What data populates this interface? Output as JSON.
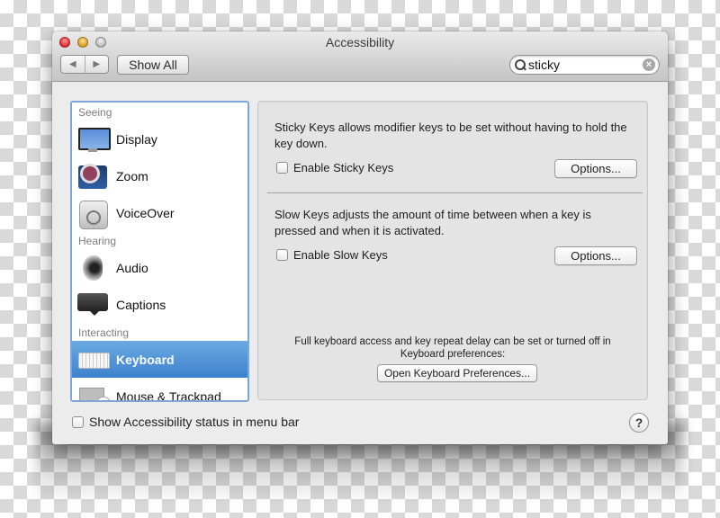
{
  "window": {
    "title": "Accessibility"
  },
  "toolbar": {
    "back_icon": "◀",
    "forward_icon": "▶",
    "show_all_label": "Show All",
    "search": {
      "value": "sticky",
      "clear_icon": "×"
    }
  },
  "sidebar": {
    "sections": [
      {
        "label": "Seeing",
        "items": [
          {
            "label": "Display",
            "icon": "display-icon"
          },
          {
            "label": "Zoom",
            "icon": "zoom-icon"
          },
          {
            "label": "VoiceOver",
            "icon": "voiceover-icon"
          }
        ]
      },
      {
        "label": "Hearing",
        "items": [
          {
            "label": "Audio",
            "icon": "audio-icon"
          },
          {
            "label": "Captions",
            "icon": "captions-icon"
          }
        ]
      },
      {
        "label": "Interacting",
        "items": [
          {
            "label": "Keyboard",
            "icon": "keyboard-icon",
            "selected": true
          },
          {
            "label": "Mouse & Trackpad",
            "icon": "mouse-trackpad-icon"
          }
        ]
      }
    ]
  },
  "pane": {
    "sticky_keys": {
      "description": "Sticky Keys allows modifier keys to be set without having to hold the key down.",
      "checkbox_label": "Enable Sticky Keys",
      "checked": false,
      "options_label": "Options..."
    },
    "slow_keys": {
      "description": "Slow Keys adjusts the amount of time between when a key is pressed and when it is activated.",
      "checkbox_label": "Enable Slow Keys",
      "checked": false,
      "options_label": "Options..."
    },
    "note_line1": "Full keyboard access and key repeat delay can be set or turned off in",
    "note_line2": "Keyboard preferences:",
    "open_prefs_label": "Open Keyboard Preferences..."
  },
  "footer": {
    "status_checkbox_label": "Show Accessibility status in menu bar",
    "status_checked": false,
    "help_label": "?"
  },
  "colors": {
    "selection": "#3e82ce",
    "sidebar_focus_border": "#7fa6d8"
  }
}
